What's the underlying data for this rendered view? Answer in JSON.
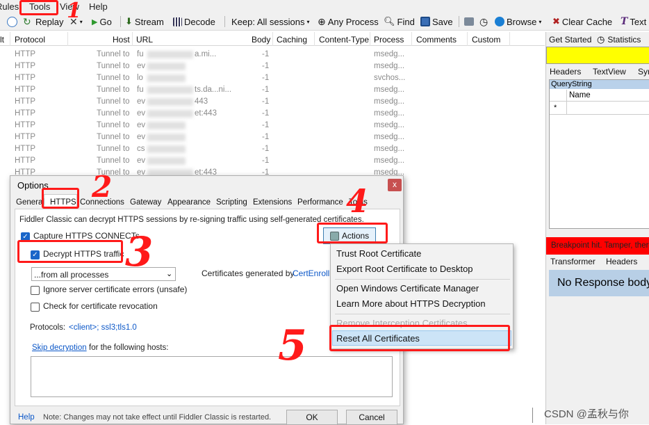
{
  "menubar": {
    "items": [
      "Rules",
      "Tools",
      "View",
      "Help"
    ]
  },
  "toolbar": {
    "replay": "Replay",
    "go": "Go",
    "stream": "Stream",
    "decode": "Decode",
    "keep": "Keep: All sessions",
    "process": "Any Process",
    "find": "Find",
    "save": "Save",
    "browse": "Browse",
    "clear_cache": "Clear Cache",
    "text": "Text"
  },
  "grid": {
    "columns": [
      "lt",
      "Protocol",
      "Host",
      "URL",
      "Body",
      "Caching",
      "Content-Type",
      "Process",
      "Comments",
      "Custom"
    ],
    "rows": [
      {
        "protocol": "HTTP",
        "host": "Tunnel to",
        "url": "fu",
        "url_tail": "a.mi...",
        "body": "-1",
        "process": "msedg..."
      },
      {
        "protocol": "HTTP",
        "host": "Tunnel to",
        "url": "ev",
        "url_tail": "",
        "body": "-1",
        "process": "msedg..."
      },
      {
        "protocol": "HTTP",
        "host": "Tunnel to",
        "url": "lo",
        "url_tail": "",
        "body": "-1",
        "process": "svchos..."
      },
      {
        "protocol": "HTTP",
        "host": "Tunnel to",
        "url": "fu",
        "url_tail": "ts.da...ni...",
        "body": "-1",
        "process": "msedg..."
      },
      {
        "protocol": "HTTP",
        "host": "Tunnel to",
        "url": "ev",
        "url_tail": "443",
        "body": "-1",
        "process": "msedg..."
      },
      {
        "protocol": "HTTP",
        "host": "Tunnel to",
        "url": "ev",
        "url_tail": "et:443",
        "body": "-1",
        "process": "msedg..."
      },
      {
        "protocol": "HTTP",
        "host": "Tunnel to",
        "url": "ev",
        "url_tail": "",
        "body": "-1",
        "process": "msedg..."
      },
      {
        "protocol": "HTTP",
        "host": "Tunnel to",
        "url": "ev",
        "url_tail": "",
        "body": "-1",
        "process": "msedg..."
      },
      {
        "protocol": "HTTP",
        "host": "Tunnel to",
        "url": "cs",
        "url_tail": "",
        "body": "-1",
        "process": "msedg..."
      },
      {
        "protocol": "HTTP",
        "host": "Tunnel to",
        "url": "ev",
        "url_tail": "",
        "body": "-1",
        "process": "msedg..."
      },
      {
        "protocol": "HTTP",
        "host": "Tunnel to",
        "url": "ev",
        "url_tail": "et:443",
        "body": "-1",
        "process": "msedg..."
      }
    ]
  },
  "right_pane": {
    "tabs_top": [
      "Get Started",
      "Statistics"
    ],
    "tabs_mid": [
      "Headers",
      "TextView",
      "Syn"
    ],
    "querystring": "QueryString",
    "name_col": "Name",
    "row_marker": "*",
    "breakpoint": "Breakpoint hit. Tamper, ther",
    "tabs_bottom": [
      "Transformer",
      "Headers"
    ],
    "no_response": "No Response body"
  },
  "dialog": {
    "title": "Options",
    "close": "x",
    "tabs": [
      "General",
      "HTTPS",
      "Connections",
      "Gateway",
      "Appearance",
      "Scripting",
      "Extensions",
      "Performance",
      "Tools"
    ],
    "intro": "Fiddler Classic can decrypt HTTPS sessions by re-signing traffic using self-generated certificates.",
    "capture": "Capture HTTPS CONNECTs",
    "decrypt": "Decrypt HTTPS traffic",
    "process_filter": "...from all processes",
    "ignore_errors": "Ignore server certificate errors (unsafe)",
    "revocation": "Check for certificate revocation",
    "cert_label": "Certificates generated by",
    "cert_link": "CertEnroll e",
    "protocols_label": "Protocols:",
    "protocols_value": "<client>; ssl3;tls1.0",
    "skip_link": "Skip decryption",
    "skip_rest": "for the following hosts:",
    "actions": "Actions",
    "help": "Help",
    "note": "Note: Changes may not take effect until Fiddler Classic is restarted.",
    "ok": "OK",
    "cancel": "Cancel"
  },
  "actions_menu": {
    "items": [
      "Trust Root Certificate",
      "Export Root Certificate to Desktop",
      "Open Windows Certificate Manager",
      "Learn More about HTTPS Decryption",
      "Remove Interception Certificates",
      "Reset All Certificates"
    ]
  },
  "annotations": {
    "n1": "1",
    "n2": "2",
    "n3": "3",
    "n4": "4",
    "n5": "5"
  },
  "watermark": "CSDN @孟秋与你",
  "icons": [
    "comment-icon",
    "replay-icon",
    "remove-icon",
    "go-icon",
    "stream-icon",
    "decode-icon",
    "target-icon",
    "find-icon",
    "save-icon",
    "screenshot-icon",
    "timer-icon",
    "browse-icon",
    "clear-cache-icon",
    "text-icon",
    "statistics-icon",
    "checkbox-icon",
    "dropdown-arrow-icon",
    "actions-icon"
  ],
  "colors": {
    "red_annotation": "#ff1a1a",
    "yellow_bar": "#ffff00",
    "breakpoint_bar": "#ff0000",
    "no_response_bg": "#b8cfe6",
    "selected_menu": "#cce4f7",
    "link": "#0b57c8"
  }
}
